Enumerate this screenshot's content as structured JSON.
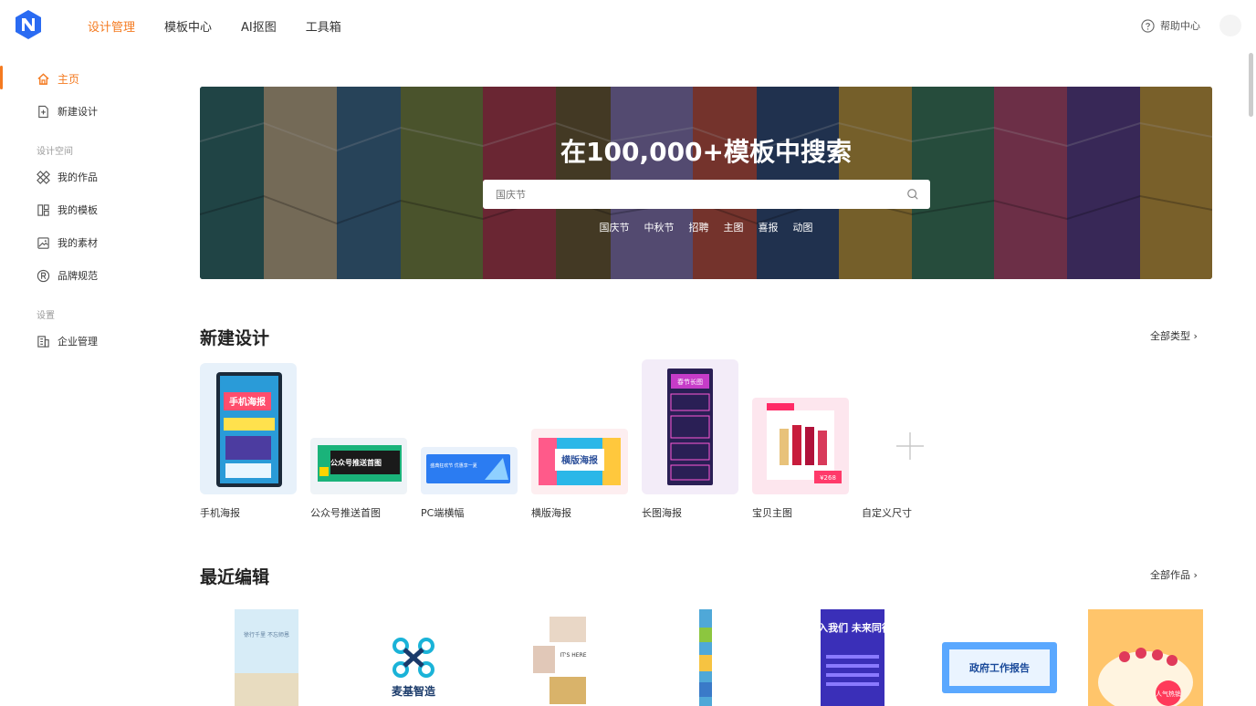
{
  "topnav": {
    "items": [
      {
        "label": "设计管理",
        "active": true
      },
      {
        "label": "模板中心",
        "active": false
      },
      {
        "label": "AI抠图",
        "active": false
      },
      {
        "label": "工具箱",
        "active": false
      }
    ],
    "help_label": "帮助中心"
  },
  "sidebar": {
    "home": "主页",
    "new_design": "新建设计",
    "section_space": "设计空间",
    "my_works": "我的作品",
    "my_templates": "我的模板",
    "my_materials": "我的素材",
    "brand_spec": "品牌规范",
    "section_settings": "设置",
    "enterprise": "企业管理"
  },
  "banner": {
    "title": "在100,000+模板中搜索",
    "search_placeholder": "国庆节",
    "tags": [
      "国庆节",
      "中秋节",
      "招聘",
      "主图",
      "喜报",
      "动图"
    ]
  },
  "new_design": {
    "title": "新建设计",
    "more": "全部类型 ›",
    "cards": [
      {
        "label": "手机海报",
        "thumb_text": "手机海报"
      },
      {
        "label": "公众号推送首图",
        "thumb_text": "公众号推送首图"
      },
      {
        "label": "PC端横幅",
        "thumb_text": "盛典狂欢节 优惠享一夏"
      },
      {
        "label": "横版海报",
        "thumb_text": "横版海报"
      },
      {
        "label": "长图海报",
        "thumb_text": "春节长图"
      },
      {
        "label": "宝贝主图",
        "thumb_text": "¥268"
      },
      {
        "label": "自定义尺寸"
      }
    ]
  },
  "recent": {
    "title": "最近编辑",
    "more": "全部作品 ›",
    "cards": [
      {
        "text": "徐行千里 不忘师恩"
      },
      {
        "text": "麦基智造"
      },
      {
        "text": "IT'S HERE"
      },
      {
        "text": ""
      },
      {
        "text": "加入我们 未来同行"
      },
      {
        "text": "政府工作报告"
      },
      {
        "text": "人气热销"
      }
    ]
  },
  "colors": {
    "accent": "#f47a20",
    "brand_blue": "#2a6bf2"
  }
}
